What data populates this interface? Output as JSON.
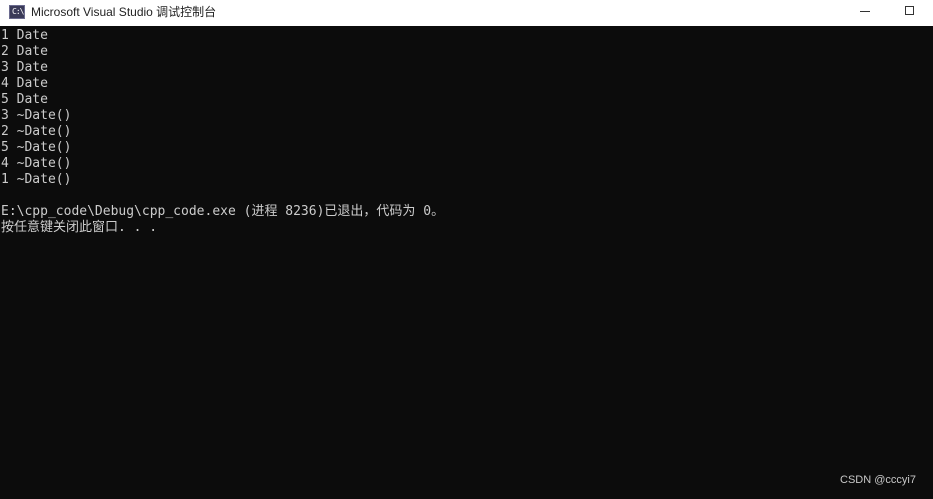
{
  "window": {
    "title": "Microsoft Visual Studio 调试控制台",
    "icon": "console-app-icon",
    "icon_glyph": "C:\\"
  },
  "controls": {
    "minimize_icon": "minimize-icon",
    "maximize_icon": "maximize-icon"
  },
  "console": {
    "lines": [
      "1 Date",
      "2 Date",
      "3 Date",
      "4 Date",
      "5 Date",
      "3 ~Date()",
      "2 ~Date()",
      "5 ~Date()",
      "4 ~Date()",
      "1 ~Date()",
      "",
      "E:\\cpp_code\\Debug\\cpp_code.exe (进程 8236)已退出，代码为 0。",
      "按任意键关闭此窗口. . ."
    ]
  },
  "watermark": "CSDN @cccyi7",
  "colors": {
    "console_bg": "#0c0c0c",
    "console_fg": "#cccccc",
    "titlebar_bg": "#ffffff"
  }
}
